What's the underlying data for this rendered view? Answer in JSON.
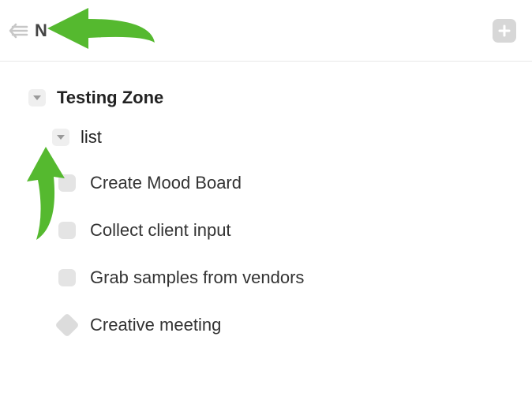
{
  "header": {
    "title": "N"
  },
  "group": {
    "name": "Testing Zone"
  },
  "list": {
    "name": "list"
  },
  "tasks": [
    {
      "label": "Create Mood Board",
      "kind": "task"
    },
    {
      "label": "Collect client input",
      "kind": "task"
    },
    {
      "label": "Grab samples from vendors",
      "kind": "task"
    },
    {
      "label": "Creative meeting",
      "kind": "milestone"
    }
  ],
  "annotation": {
    "arrow_color": "#55b92f"
  }
}
